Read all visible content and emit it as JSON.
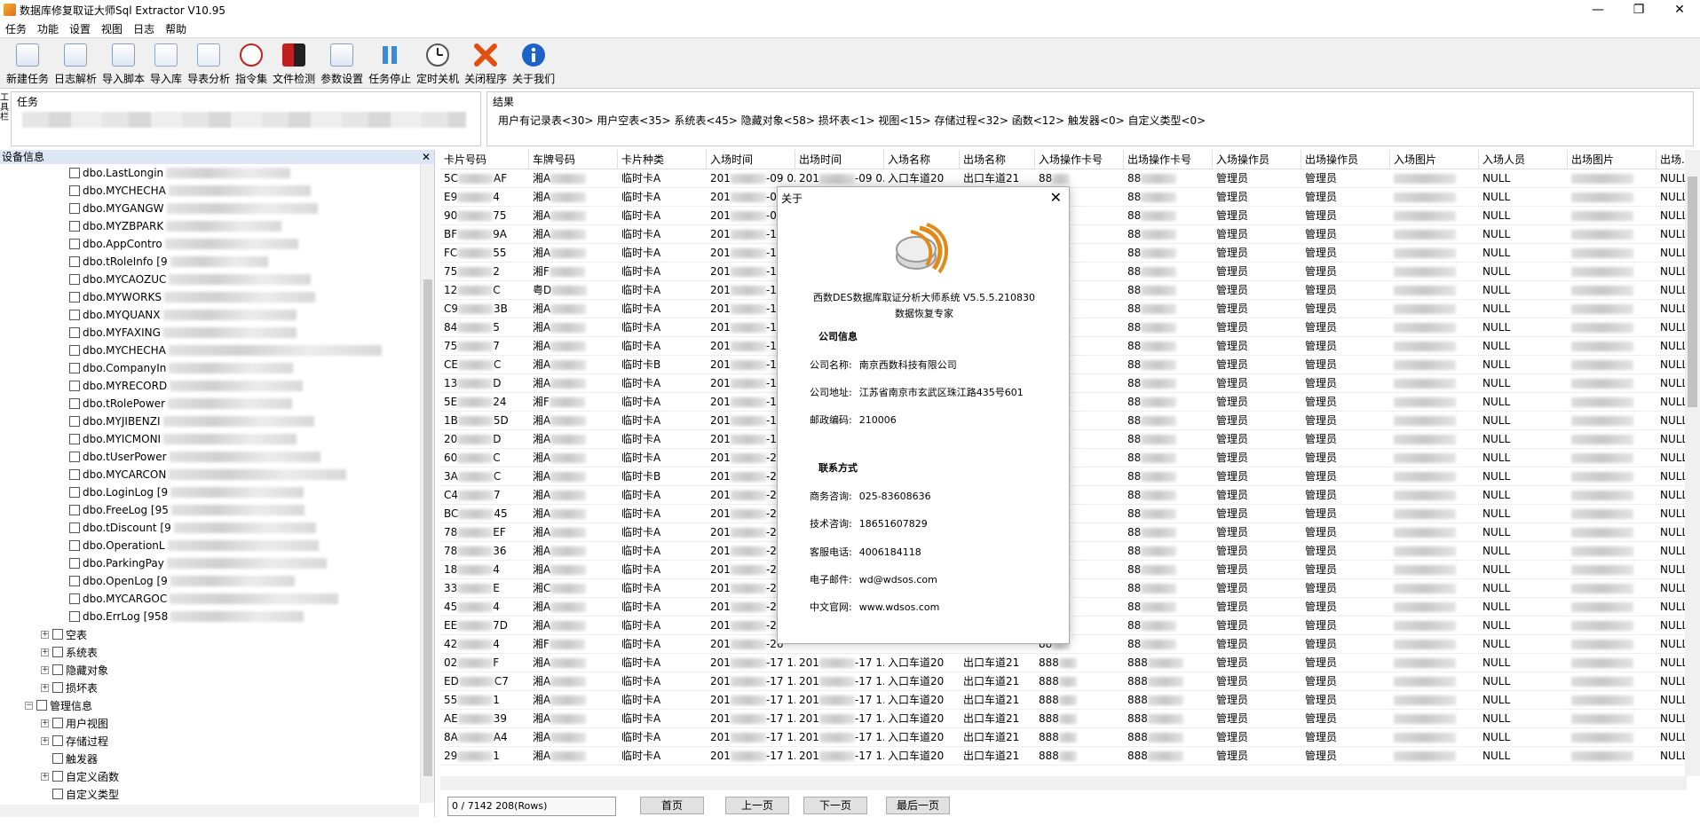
{
  "window": {
    "title": "数据库修复取证大师Sql Extractor V10.95",
    "min": "—",
    "max": "❐",
    "close": "✕"
  },
  "menu": [
    "任务",
    "功能",
    "设置",
    "视图",
    "日志",
    "帮助"
  ],
  "toolbar": [
    {
      "label": "新建任务",
      "icon": "new-task-icon"
    },
    {
      "label": "日志解析",
      "icon": "log-parse-icon"
    },
    {
      "label": "导入脚本",
      "icon": "import-script-icon"
    },
    {
      "label": "导入库",
      "icon": "import-db-icon"
    },
    {
      "label": "导表分析",
      "icon": "table-analysis-icon"
    },
    {
      "label": "指令集",
      "icon": "command-set-icon"
    },
    {
      "label": "文件检测",
      "icon": "file-check-icon"
    },
    {
      "label": "参数设置",
      "icon": "settings-doc-icon"
    },
    {
      "label": "任务停止",
      "icon": "pause-icon"
    },
    {
      "label": "定时关机",
      "icon": "clock-icon"
    },
    {
      "label": "关闭程序",
      "icon": "close-x-icon"
    },
    {
      "label": "关于我们",
      "icon": "info-icon"
    }
  ],
  "task_panel": {
    "side_tab": "工具栏",
    "label": "任务"
  },
  "result_panel": {
    "label": "结果",
    "text": "用户有记录表<30> 用户空表<35> 系统表<45> 隐藏对象<58> 损坏表<1> 视图<15> 存储过程<32> 函数<12> 触发器<0> 自定义类型<0>"
  },
  "left_panel": {
    "title": "设备信息",
    "close": "✕",
    "tables": [
      "dbo.LastLongin",
      "dbo.MYCHECHA",
      "dbo.MYGANGW",
      "dbo.MYZBPARK",
      "dbo.AppContro",
      "dbo.tRoleInfo [9",
      "dbo.MYCAOZUC",
      "dbo.MYWORKS",
      "dbo.MYQUANX",
      "dbo.MYFAXING",
      "dbo.MYCHECHA",
      "dbo.CompanyIn",
      "dbo.MYRECORD",
      "dbo.tRolePower",
      "dbo.MYJIBENZI",
      "dbo.MYICMONI",
      "dbo.tUserPower",
      "dbo.MYCARCON",
      "dbo.LoginLog [9",
      "dbo.FreeLog [95",
      "dbo.tDiscount [9",
      "dbo.OperationL",
      "dbo.ParkingPay",
      "dbo.OpenLog [9",
      "dbo.MYCARGOC",
      "dbo.ErrLog [958"
    ],
    "groups": [
      {
        "label": "空表",
        "exp": "+"
      },
      {
        "label": "系统表",
        "exp": "+"
      },
      {
        "label": "隐藏对象",
        "exp": "+"
      },
      {
        "label": "损坏表",
        "exp": "+"
      }
    ],
    "mgmt": {
      "label": "管理信息",
      "exp": "−"
    },
    "mgmt_items": [
      {
        "label": "用户视图",
        "exp": "+"
      },
      {
        "label": "存储过程",
        "exp": "+"
      },
      {
        "label": "触发器",
        "exp": ""
      },
      {
        "label": "自定义函数",
        "exp": "+"
      },
      {
        "label": "自定义类型",
        "exp": ""
      }
    ]
  },
  "grid": {
    "columns": [
      "卡片号码",
      "车牌号码",
      "卡片种类",
      "入场时间",
      "出场时间",
      "入场名称",
      "出场名称",
      "入场操作卡号",
      "出场操作卡号",
      "入场操作员",
      "出场操作员",
      "入场图片",
      "入场人员",
      "出场图片",
      "出场..."
    ],
    "rows": [
      [
        "5C",
        "AF",
        "湘A",
        "临时卡A",
        "201",
        "-09 0...",
        "201",
        "-09 0...",
        "入口车道20",
        "出口车道21",
        "88"
      ],
      [
        "E9",
        "4",
        "湘A",
        "临时卡A",
        "201",
        "-09",
        "",
        "",
        "",
        "",
        "88"
      ],
      [
        "90",
        "75",
        "湘A",
        "临时卡A",
        "201",
        "-09",
        "",
        "",
        "",
        "",
        "88"
      ],
      [
        "BF",
        "9A",
        "湘A",
        "临时卡A",
        "201",
        "-10",
        "",
        "",
        "",
        "",
        "88"
      ],
      [
        "FC",
        "55",
        "湘A",
        "临时卡A",
        "201",
        "-11",
        "",
        "",
        "",
        "",
        "88"
      ],
      [
        "75",
        "2",
        "湘F",
        "临时卡A",
        "201",
        "-12",
        "",
        "",
        "",
        "",
        "88"
      ],
      [
        "12",
        "C",
        "粤D",
        "临时卡A",
        "201",
        "-12",
        "",
        "",
        "",
        "",
        "88"
      ],
      [
        "C9",
        "3B",
        "湘A",
        "临时卡A",
        "201",
        "-12",
        "",
        "",
        "",
        "",
        "88"
      ],
      [
        "84",
        "5",
        "湘A",
        "临时卡A",
        "201",
        "-13",
        "",
        "",
        "",
        "",
        "88"
      ],
      [
        "75",
        "7",
        "湘A",
        "临时卡A",
        "201",
        "-14",
        "",
        "",
        "",
        "",
        "88"
      ],
      [
        "CE",
        "C",
        "湘A",
        "临时卡B",
        "201",
        "-14",
        "",
        "",
        "",
        "",
        "88"
      ],
      [
        "13",
        "D",
        "湘A",
        "临时卡A",
        "201",
        "-16",
        "",
        "",
        "",
        "",
        "88"
      ],
      [
        "5E",
        "24",
        "湘F",
        "临时卡A",
        "201",
        "-16",
        "",
        "",
        "",
        "",
        "88"
      ],
      [
        "1B",
        "5D",
        "湘A",
        "临时卡A",
        "201",
        "-17",
        "",
        "",
        "",
        "",
        "88"
      ],
      [
        "20",
        "D",
        "湘A",
        "临时卡A",
        "201",
        "-18",
        "",
        "",
        "",
        "",
        "88"
      ],
      [
        "60",
        "C",
        "湘A",
        "临时卡A",
        "201",
        "-20",
        "",
        "",
        "",
        "",
        "88"
      ],
      [
        "3A",
        "C",
        "湘A",
        "临时卡B",
        "201",
        "-20",
        "",
        "",
        "",
        "",
        "88"
      ],
      [
        "C4",
        "7",
        "湘A",
        "临时卡A",
        "201",
        "-22",
        "",
        "",
        "",
        "",
        "88"
      ],
      [
        "BC",
        "45",
        "湘A",
        "临时卡A",
        "201",
        "-22",
        "",
        "",
        "",
        "",
        "88"
      ],
      [
        "78",
        "EF",
        "湘A",
        "临时卡A",
        "201",
        "-24",
        "",
        "",
        "",
        "",
        "88"
      ],
      [
        "78",
        "36",
        "湘A",
        "临时卡A",
        "201",
        "-25",
        "",
        "",
        "",
        "",
        "88"
      ],
      [
        "18",
        "4",
        "湘A",
        "临时卡A",
        "201",
        "-25",
        "",
        "",
        "",
        "",
        "88"
      ],
      [
        "33",
        "E",
        "湘C",
        "临时卡A",
        "201",
        "-25",
        "",
        "",
        "",
        "",
        "88"
      ],
      [
        "45",
        "4",
        "湘A",
        "临时卡A",
        "201",
        "-25",
        "",
        "",
        "",
        "",
        "88"
      ],
      [
        "EE",
        "7D",
        "湘A",
        "临时卡A",
        "201",
        "-26",
        "",
        "",
        "",
        "",
        "88"
      ],
      [
        "42",
        "4",
        "湘F",
        "临时卡A",
        "201",
        "-26",
        "",
        "",
        "",
        "",
        "88"
      ],
      [
        "02",
        "F",
        "湘A",
        "临时卡A",
        "201",
        "-17 1...",
        "201",
        "-17 1...",
        "入口车道20",
        "出口车道21",
        "888"
      ],
      [
        "ED",
        "C7",
        "湘A",
        "临时卡A",
        "201",
        "-17 1...",
        "201",
        "-17 1...",
        "入口车道20",
        "出口车道21",
        "888"
      ],
      [
        "55",
        "1",
        "湘A",
        "临时卡A",
        "201",
        "-17 1...",
        "201",
        "-17 1...",
        "入口车道20",
        "出口车道21",
        "888"
      ],
      [
        "AE",
        "39",
        "湘A",
        "临时卡A",
        "201",
        "-17 1...",
        "201",
        "-17 1...",
        "入口车道20",
        "出口车道21",
        "888"
      ],
      [
        "8A",
        "A4",
        "湘A",
        "临时卡A",
        "201",
        "-17 1...",
        "201",
        "-17 1...",
        "入口车道20",
        "出口车道21",
        "888"
      ],
      [
        "29",
        "1",
        "湘A",
        "临时卡A",
        "201",
        "-17 1...",
        "201",
        "-17 1...",
        "入口车道20",
        "出口车道21",
        "888"
      ]
    ],
    "op_in": "管理员",
    "op_out": "管理员",
    "null": "NULL"
  },
  "pager": {
    "info": "0 / 7142  208(Rows)",
    "first": "首页",
    "prev": "上一页",
    "next": "下一页",
    "last": "最后一页"
  },
  "about": {
    "title": "关于",
    "close": "✕",
    "product": "西数DES数据库取证分析大师系统 V5.5.5.210830",
    "subtitle": "数据恢复专家",
    "company_section": "公司信息",
    "company_name_label": "公司名称:",
    "company_name": "南京西数科技有限公司",
    "address_label": "公司地址:",
    "address": "江苏省南京市玄武区珠江路435号601",
    "zip_label": "邮政编码:",
    "zip": "210006",
    "contact_section": "联系方式",
    "biz_label": "商务咨询:",
    "biz": "025-83608636",
    "tech_label": "技术咨询:",
    "tech": "18651607829",
    "service_label": "客服电话:",
    "service": "4006184118",
    "email_label": "电子邮件:",
    "email": "wd@wdsos.com",
    "web_label": "中文官网:",
    "web": "www.wdsos.com"
  }
}
